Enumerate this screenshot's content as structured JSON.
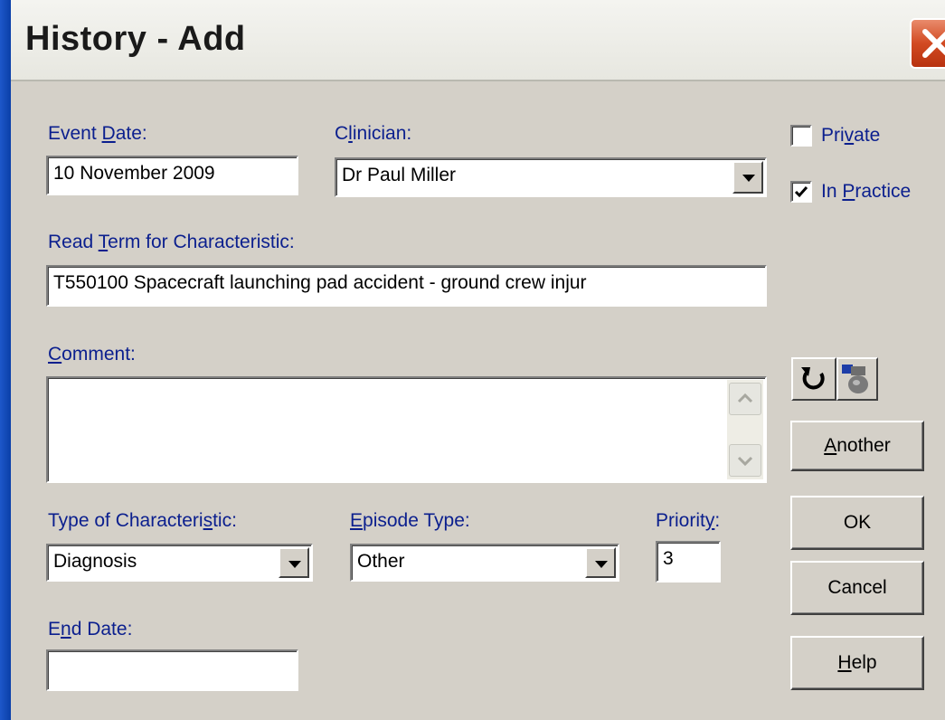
{
  "window": {
    "title": "History - Add"
  },
  "form": {
    "event_date": {
      "label_pre": "Event ",
      "label_key": "D",
      "label_post": "ate:",
      "value": "10 November 2009"
    },
    "clinician": {
      "label_pre": "C",
      "label_key": "l",
      "label_post": "inician:",
      "value": "Dr Paul Miller"
    },
    "read_term": {
      "label_pre": "Read ",
      "label_key": "T",
      "label_post": "erm for Characteristic:",
      "value": "T550100  Spacecraft launching pad accident - ground crew injur"
    },
    "comment": {
      "label_pre": "",
      "label_key": "C",
      "label_post": "omment:",
      "value": ""
    },
    "type_of_characteristic": {
      "label_pre": "Type of Characteri",
      "label_key": "s",
      "label_post": "tic:",
      "value": "Diagnosis"
    },
    "episode_type": {
      "label_pre": "",
      "label_key": "E",
      "label_post": "pisode Type:",
      "value": "Other"
    },
    "priority": {
      "label_pre": "Priorit",
      "label_key": "y",
      "label_post": ":",
      "value": "3"
    },
    "end_date": {
      "label_pre": "E",
      "label_key": "n",
      "label_post": "d Date:",
      "value": ""
    }
  },
  "options": {
    "private": {
      "label_pre": "Pri",
      "label_key": "v",
      "label_post": "ate",
      "checked": false
    },
    "in_practice": {
      "label_pre": "In ",
      "label_key": "P",
      "label_post": "ractice",
      "checked": true
    }
  },
  "buttons": {
    "another": {
      "label_key": "A",
      "label_post": "nother"
    },
    "ok": {
      "label": "OK"
    },
    "cancel": {
      "label": "Cancel"
    },
    "help": {
      "label_key": "H",
      "label_post": "elp"
    }
  },
  "icons": {
    "refresh": "refresh-icon",
    "lookup": "lookup-icon"
  },
  "colors": {
    "label": "#0b1f8e",
    "dialog_bg": "#d4d0c8",
    "close_button": "#d24a22",
    "frame": "#0a3fa8"
  }
}
